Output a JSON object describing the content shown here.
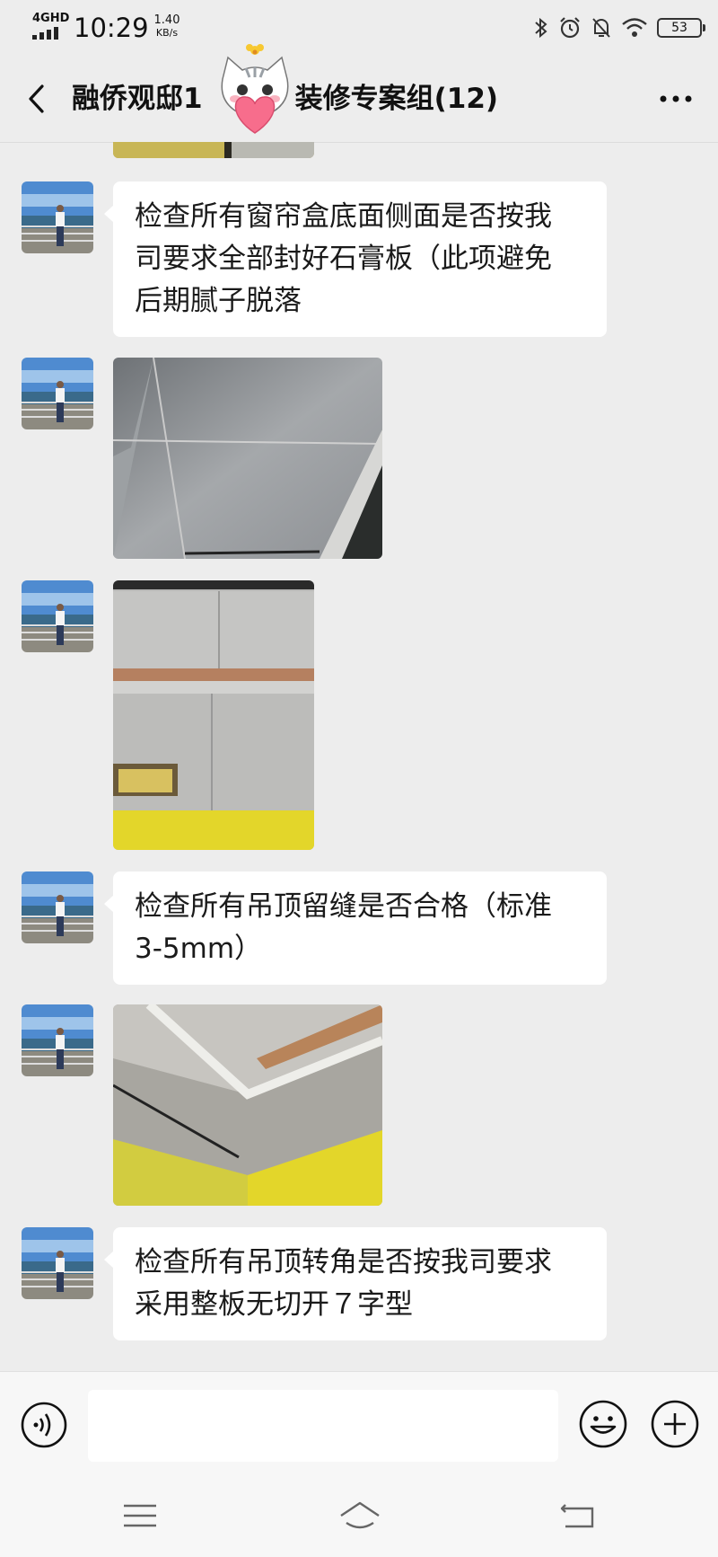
{
  "status_bar": {
    "network": "4GHD",
    "time": "10:29",
    "speed_value": "1.40",
    "speed_unit": "KB/s",
    "battery": "53"
  },
  "header": {
    "title_part1": "融侨观邸1",
    "title_part2": "装修专案组(12)",
    "back_icon": "chevron-left-icon",
    "more_icon": "more-dots-icon"
  },
  "messages": [
    {
      "type": "image",
      "description": "partial"
    },
    {
      "type": "text",
      "lines": [
        "检查所有窗帘盒底面侧面是否按我",
        "司要求全部封好石膏板（此项避免",
        "后期腻子脱落"
      ]
    },
    {
      "type": "image"
    },
    {
      "type": "image"
    },
    {
      "type": "text",
      "lines": [
        "检查所有吊顶留缝是否合格（标准",
        "3-5mm）"
      ]
    },
    {
      "type": "image"
    },
    {
      "type": "text",
      "lines": [
        "检查所有吊顶转角是否按我司要求",
        "采用整板无切开７字型"
      ]
    }
  ],
  "input_bar": {
    "voice_icon": "voice-icon",
    "emoji_icon": "emoji-icon",
    "plus_icon": "plus-icon",
    "text": ""
  },
  "system_nav": {
    "menu_icon": "menu-icon",
    "home_icon": "home-icon",
    "back_icon": "return-icon"
  },
  "colors": {
    "background": "#ededed",
    "bubble": "#ffffff",
    "ceiling_yellow": "#e3d62a"
  }
}
